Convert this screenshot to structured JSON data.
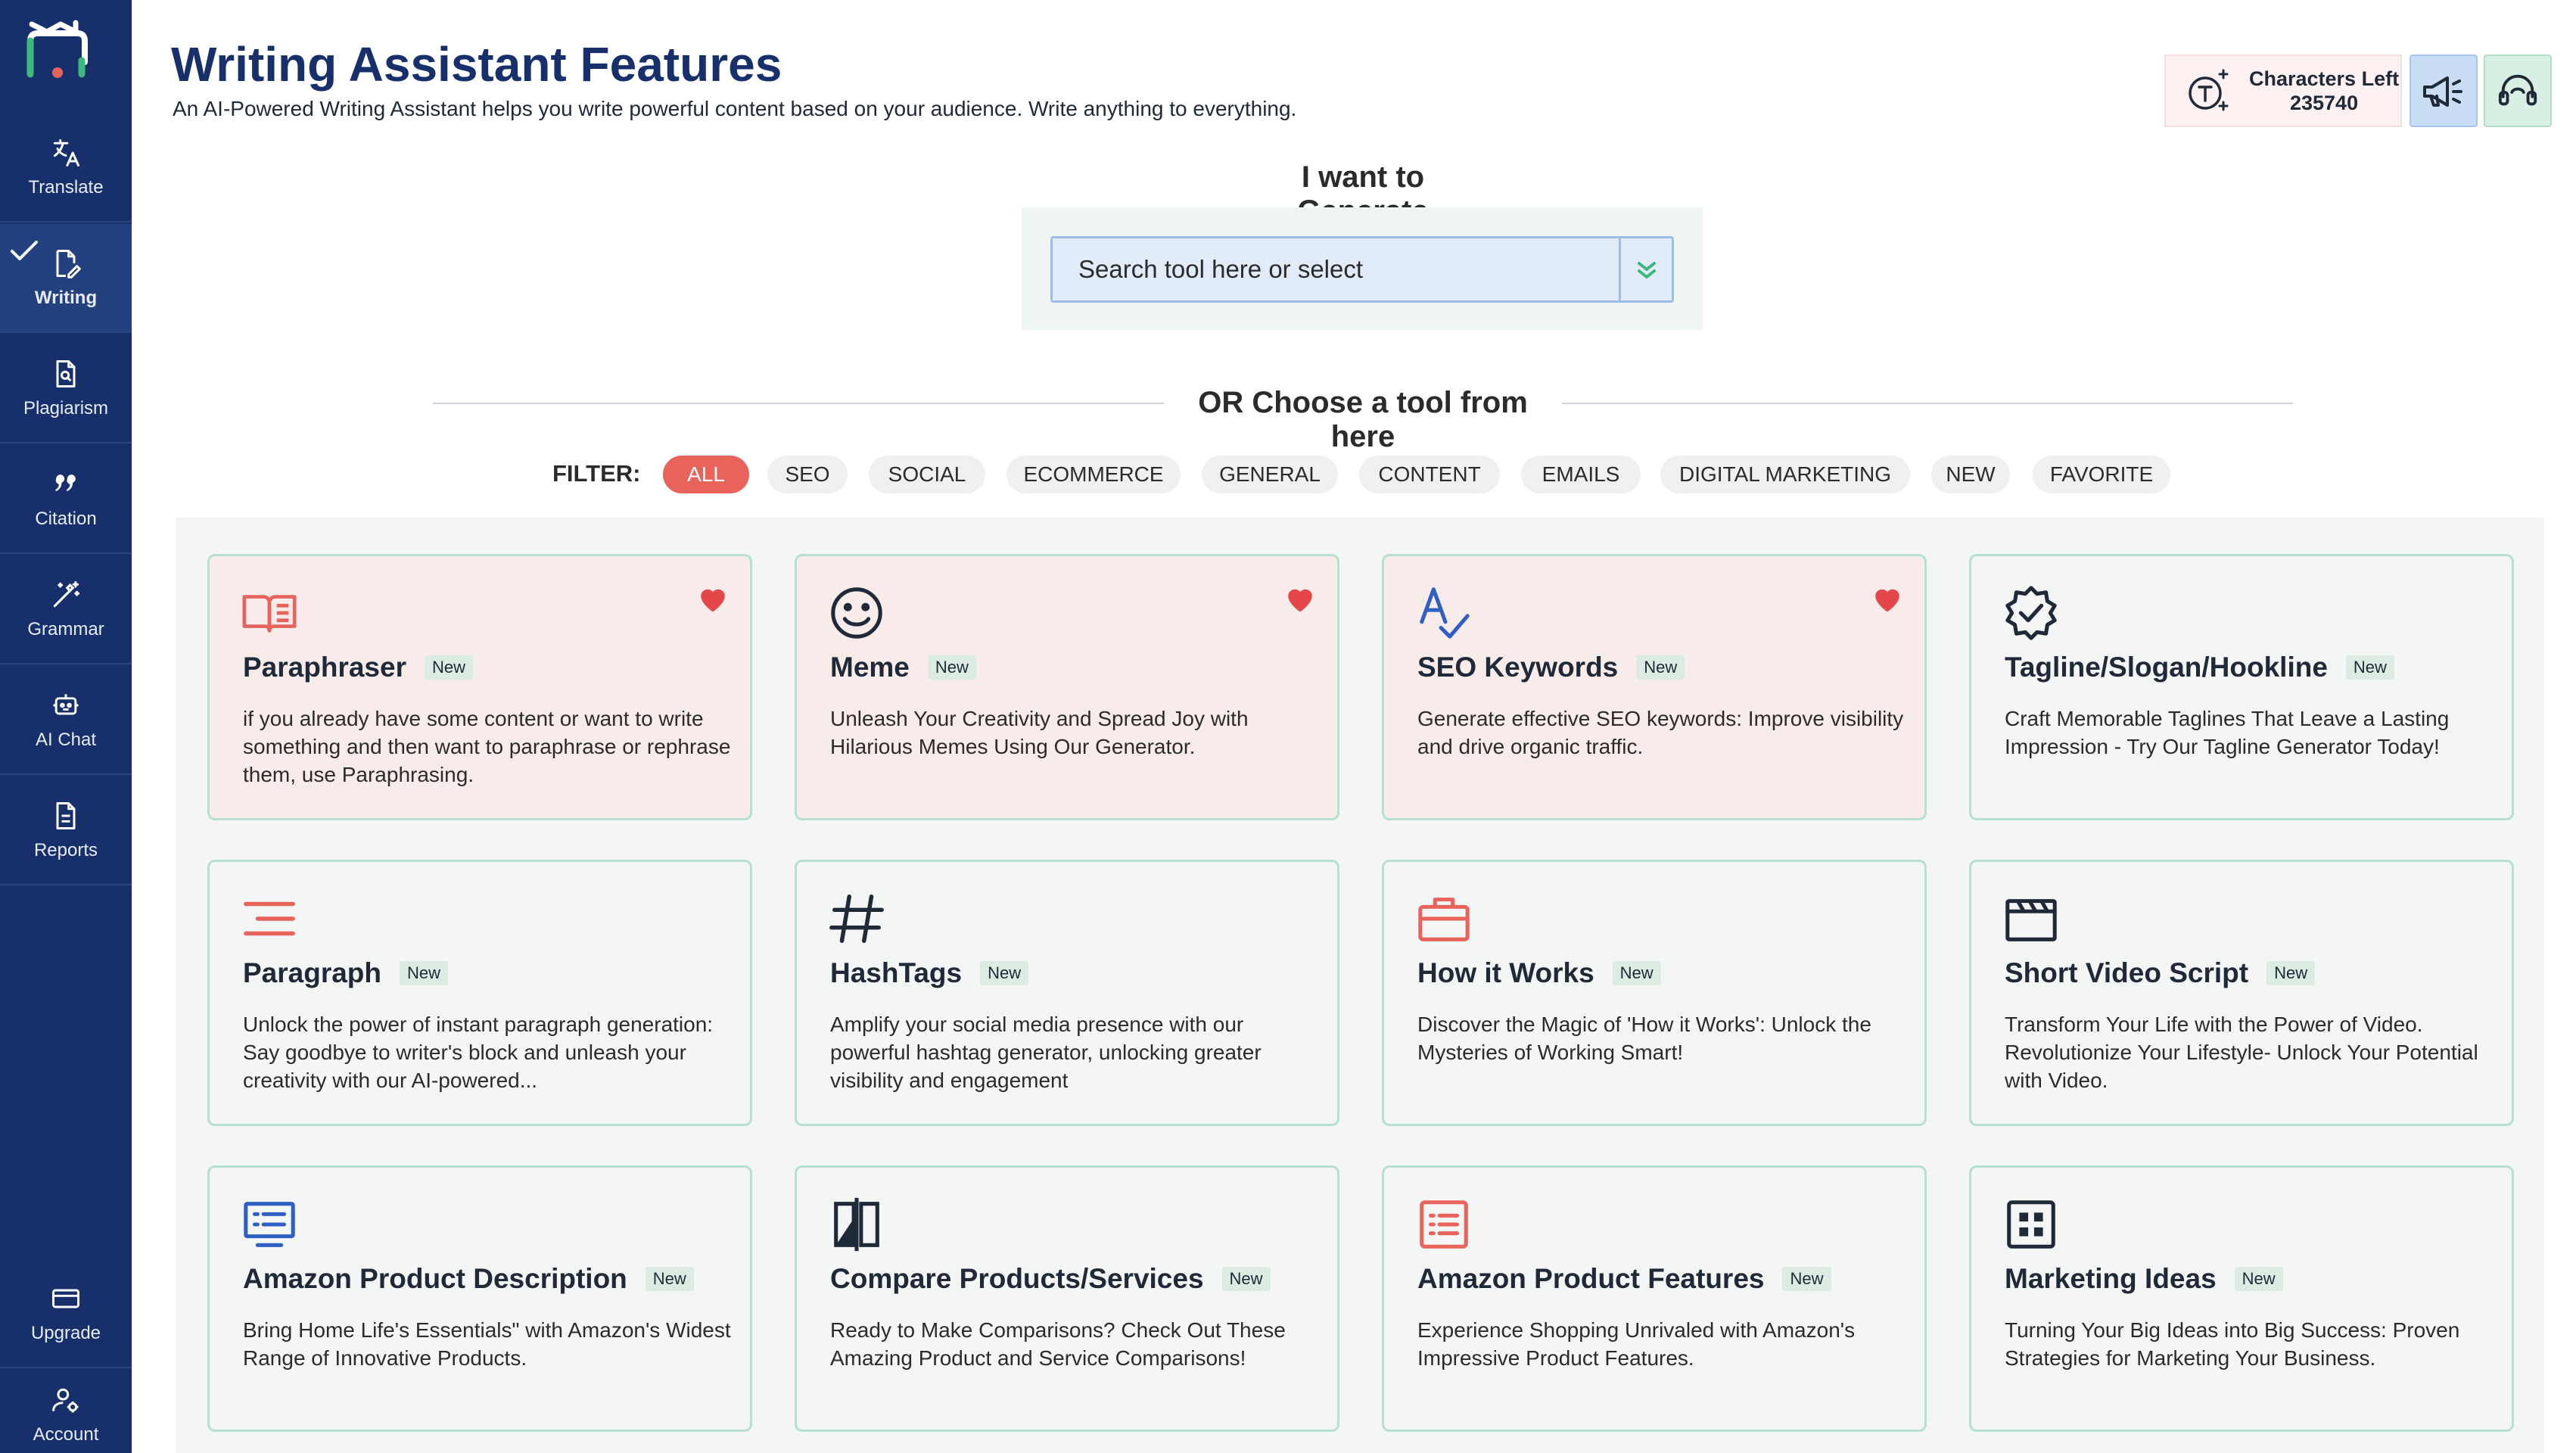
{
  "sidebar": {
    "items": [
      {
        "label": "Translate",
        "icon": "translate-icon"
      },
      {
        "label": "Writing",
        "icon": "writing-icon",
        "active": true
      },
      {
        "label": "Plagiarism",
        "icon": "plagiarism-icon"
      },
      {
        "label": "Citation",
        "icon": "citation-icon"
      },
      {
        "label": "Grammar",
        "icon": "grammar-icon"
      },
      {
        "label": "AI Chat",
        "icon": "ai-chat-icon"
      },
      {
        "label": "Reports",
        "icon": "reports-icon"
      }
    ],
    "upgrade_label": "Upgrade",
    "account_label": "Account"
  },
  "header": {
    "title": "Writing Assistant Features",
    "subtitle": "An AI-Powered Writing Assistant helps you write powerful content based on your audience. Write anything to everything.",
    "characters_left_label": "Characters Left",
    "characters_left_value": "235740"
  },
  "generate": {
    "title": "I want to Generate",
    "placeholder": "Search tool here or select"
  },
  "divider_text": "OR Choose a tool from here",
  "filter": {
    "label": "FILTER:",
    "chips": [
      "ALL",
      "SEO",
      "SOCIAL",
      "ECOMMERCE",
      "GENERAL",
      "CONTENT",
      "EMAILS",
      "DIGITAL MARKETING",
      "NEW",
      "FAVORITE"
    ],
    "active": "ALL"
  },
  "cards": [
    {
      "title": "Paraphraser",
      "badge": "New",
      "desc": "if you already have some content or want to write something and then want to paraphrase or rephrase them, use Paraphrasing.",
      "icon": "open-book-icon",
      "favorite": true
    },
    {
      "title": "Meme",
      "badge": "New",
      "desc": "Unleash Your Creativity and Spread Joy with Hilarious Memes Using Our Generator.",
      "icon": "smiley-icon",
      "favorite": true
    },
    {
      "title": "SEO Keywords",
      "badge": "New",
      "desc": "Generate effective SEO keywords: Improve visibility and drive organic traffic.",
      "icon": "spellcheck-icon",
      "favorite": true
    },
    {
      "title": "Tagline/Slogan/Hookline",
      "badge": "New",
      "desc": "Craft Memorable Taglines That Leave a Lasting Impression - Try Our Tagline Generator Today!",
      "icon": "verified-badge-icon",
      "favorite": false
    },
    {
      "title": "Paragraph",
      "badge": "New",
      "desc": "Unlock the power of instant paragraph generation: Say goodbye to writer's block and unleash your creativity with our AI-powered...",
      "icon": "paragraph-lines-icon",
      "favorite": false
    },
    {
      "title": "HashTags",
      "badge": "New",
      "desc": "Amplify your social media presence with our powerful hashtag generator, unlocking greater visibility and engagement",
      "icon": "hashtag-icon",
      "favorite": false
    },
    {
      "title": "How it Works",
      "badge": "New",
      "desc": "Discover the Magic of 'How it Works': Unlock the Mysteries of Working Smart!",
      "icon": "briefcase-icon",
      "favorite": false
    },
    {
      "title": "Short Video Script",
      "badge": "New",
      "desc": "Transform Your Life with the Power of Video. Revolutionize Your Lifestyle- Unlock Your Potential with Video.",
      "icon": "clapperboard-icon",
      "favorite": false
    },
    {
      "title": "Amazon Product Description",
      "badge": "New",
      "desc": "Bring Home Life's Essentials\" with Amazon's Widest Range of Innovative Products.",
      "icon": "monitor-list-icon",
      "favorite": false
    },
    {
      "title": "Compare Products/Services",
      "badge": "New",
      "desc": "Ready to Make Comparisons? Check Out These Amazing Product and Service Comparisons!",
      "icon": "compare-icon",
      "favorite": false
    },
    {
      "title": "Amazon Product Features",
      "badge": "New",
      "desc": "Experience Shopping Unrivaled with Amazon's Impressive Product Features.",
      "icon": "checklist-icon",
      "favorite": false
    },
    {
      "title": "Marketing Ideas",
      "badge": "New",
      "desc": "Turning Your Big Ideas into Big Success: Proven Strategies for Marketing Your Business.",
      "icon": "grid-icon",
      "favorite": false
    }
  ],
  "colors": {
    "sidebar_bg": "#17306b",
    "accent_red": "#e9635d",
    "title_navy": "#17306b",
    "card_border": "#b6e0cf"
  }
}
